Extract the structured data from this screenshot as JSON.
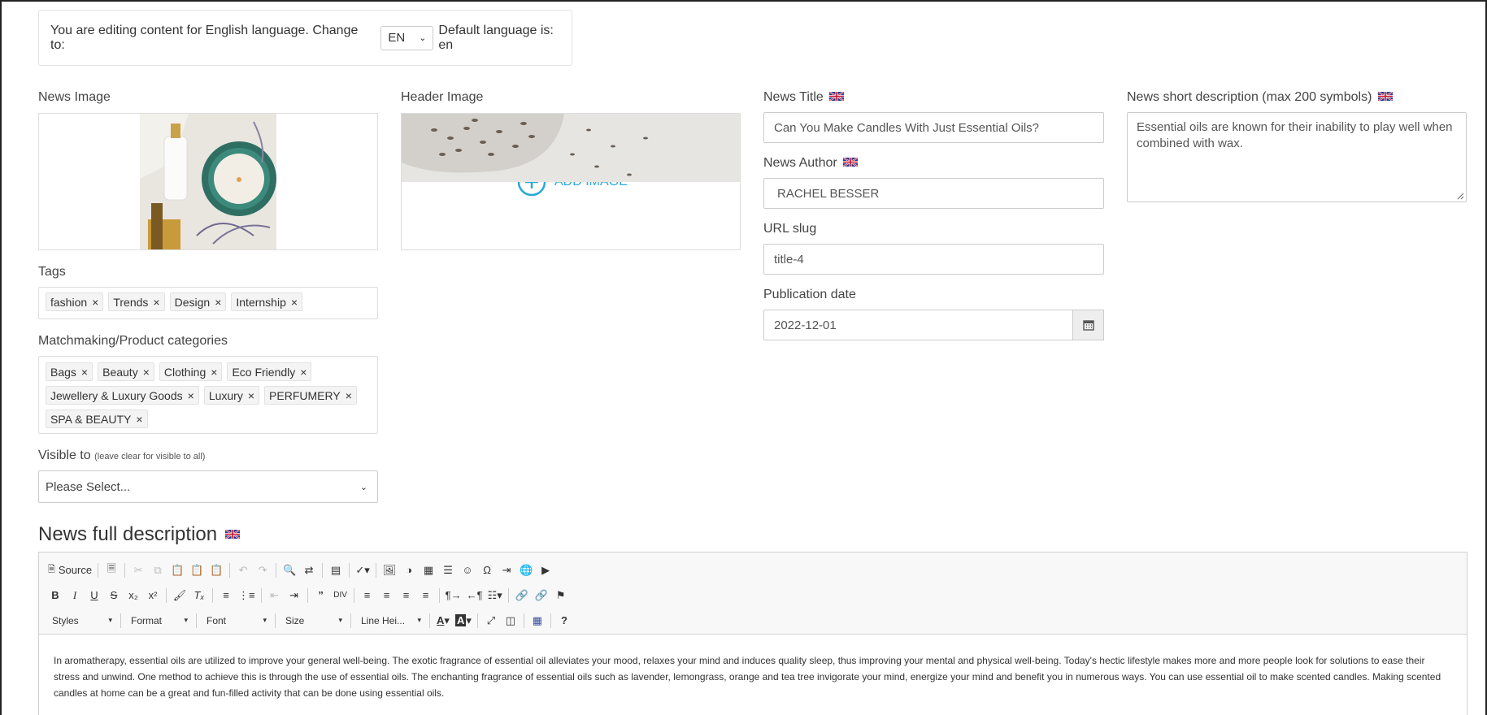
{
  "language_bar": {
    "editing_text": "You are editing content for English language. Change to:",
    "lang_value": "EN",
    "default_text": "Default language is: en"
  },
  "news_image": {
    "label": "News Image"
  },
  "header_image": {
    "label": "Header Image",
    "add_label": "ADD IMAGE"
  },
  "tags": {
    "label": "Tags",
    "items": [
      "fashion",
      "Trends",
      "Design",
      "Internship"
    ]
  },
  "categories": {
    "label": "Matchmaking/Product categories",
    "items": [
      "Bags",
      "Beauty",
      "Clothing",
      "Eco Friendly",
      "Jewellery & Luxury Goods",
      "Luxury",
      "PERFUMERY",
      "SPA & BEAUTY"
    ]
  },
  "visible_to": {
    "label": "Visible to",
    "hint": "(leave clear for visible to all)",
    "value": "Please Select..."
  },
  "news_title": {
    "label": "News Title",
    "value": "Can You Make Candles With Just Essential Oils?"
  },
  "news_author": {
    "label": "News Author",
    "value": "RACHEL BESSER"
  },
  "url_slug": {
    "label": "URL slug",
    "value": "title-4"
  },
  "publication_date": {
    "label": "Publication date",
    "value": "2022-12-01"
  },
  "short_description": {
    "label": "News short description (max 200 symbols)",
    "value": "Essential oils are known for their inability to play well when combined with wax."
  },
  "full_description": {
    "label": "News full description",
    "toolbar": {
      "source_label": "Source",
      "styles_label": "Styles",
      "format_label": "Format",
      "font_label": "Font",
      "size_label": "Size",
      "lineheight_label": "Line Hei..."
    },
    "content": "In aromatherapy, essential oils are utilized to improve your general well-being. The exotic fragrance of essential oil alleviates your mood, relaxes your mind and induces quality sleep, thus improving your mental and physical well-being. Today's hectic lifestyle makes more and more people look for solutions to ease their stress and unwind. One method to achieve this is through the use of essential oils. The enchanting fragrance of essential oils such as lavender, lemongrass, orange and tea tree invigorate your mind, energize your mind and benefit you in numerous ways. You can use essential oil to make scented candles. Making scented candles at home can be a great and fun-filled activity that can be done using essential oils."
  },
  "colors": {
    "accent": "#29a9d6",
    "border": "#cccccc",
    "toolbar_bg": "#f8f8f8"
  }
}
